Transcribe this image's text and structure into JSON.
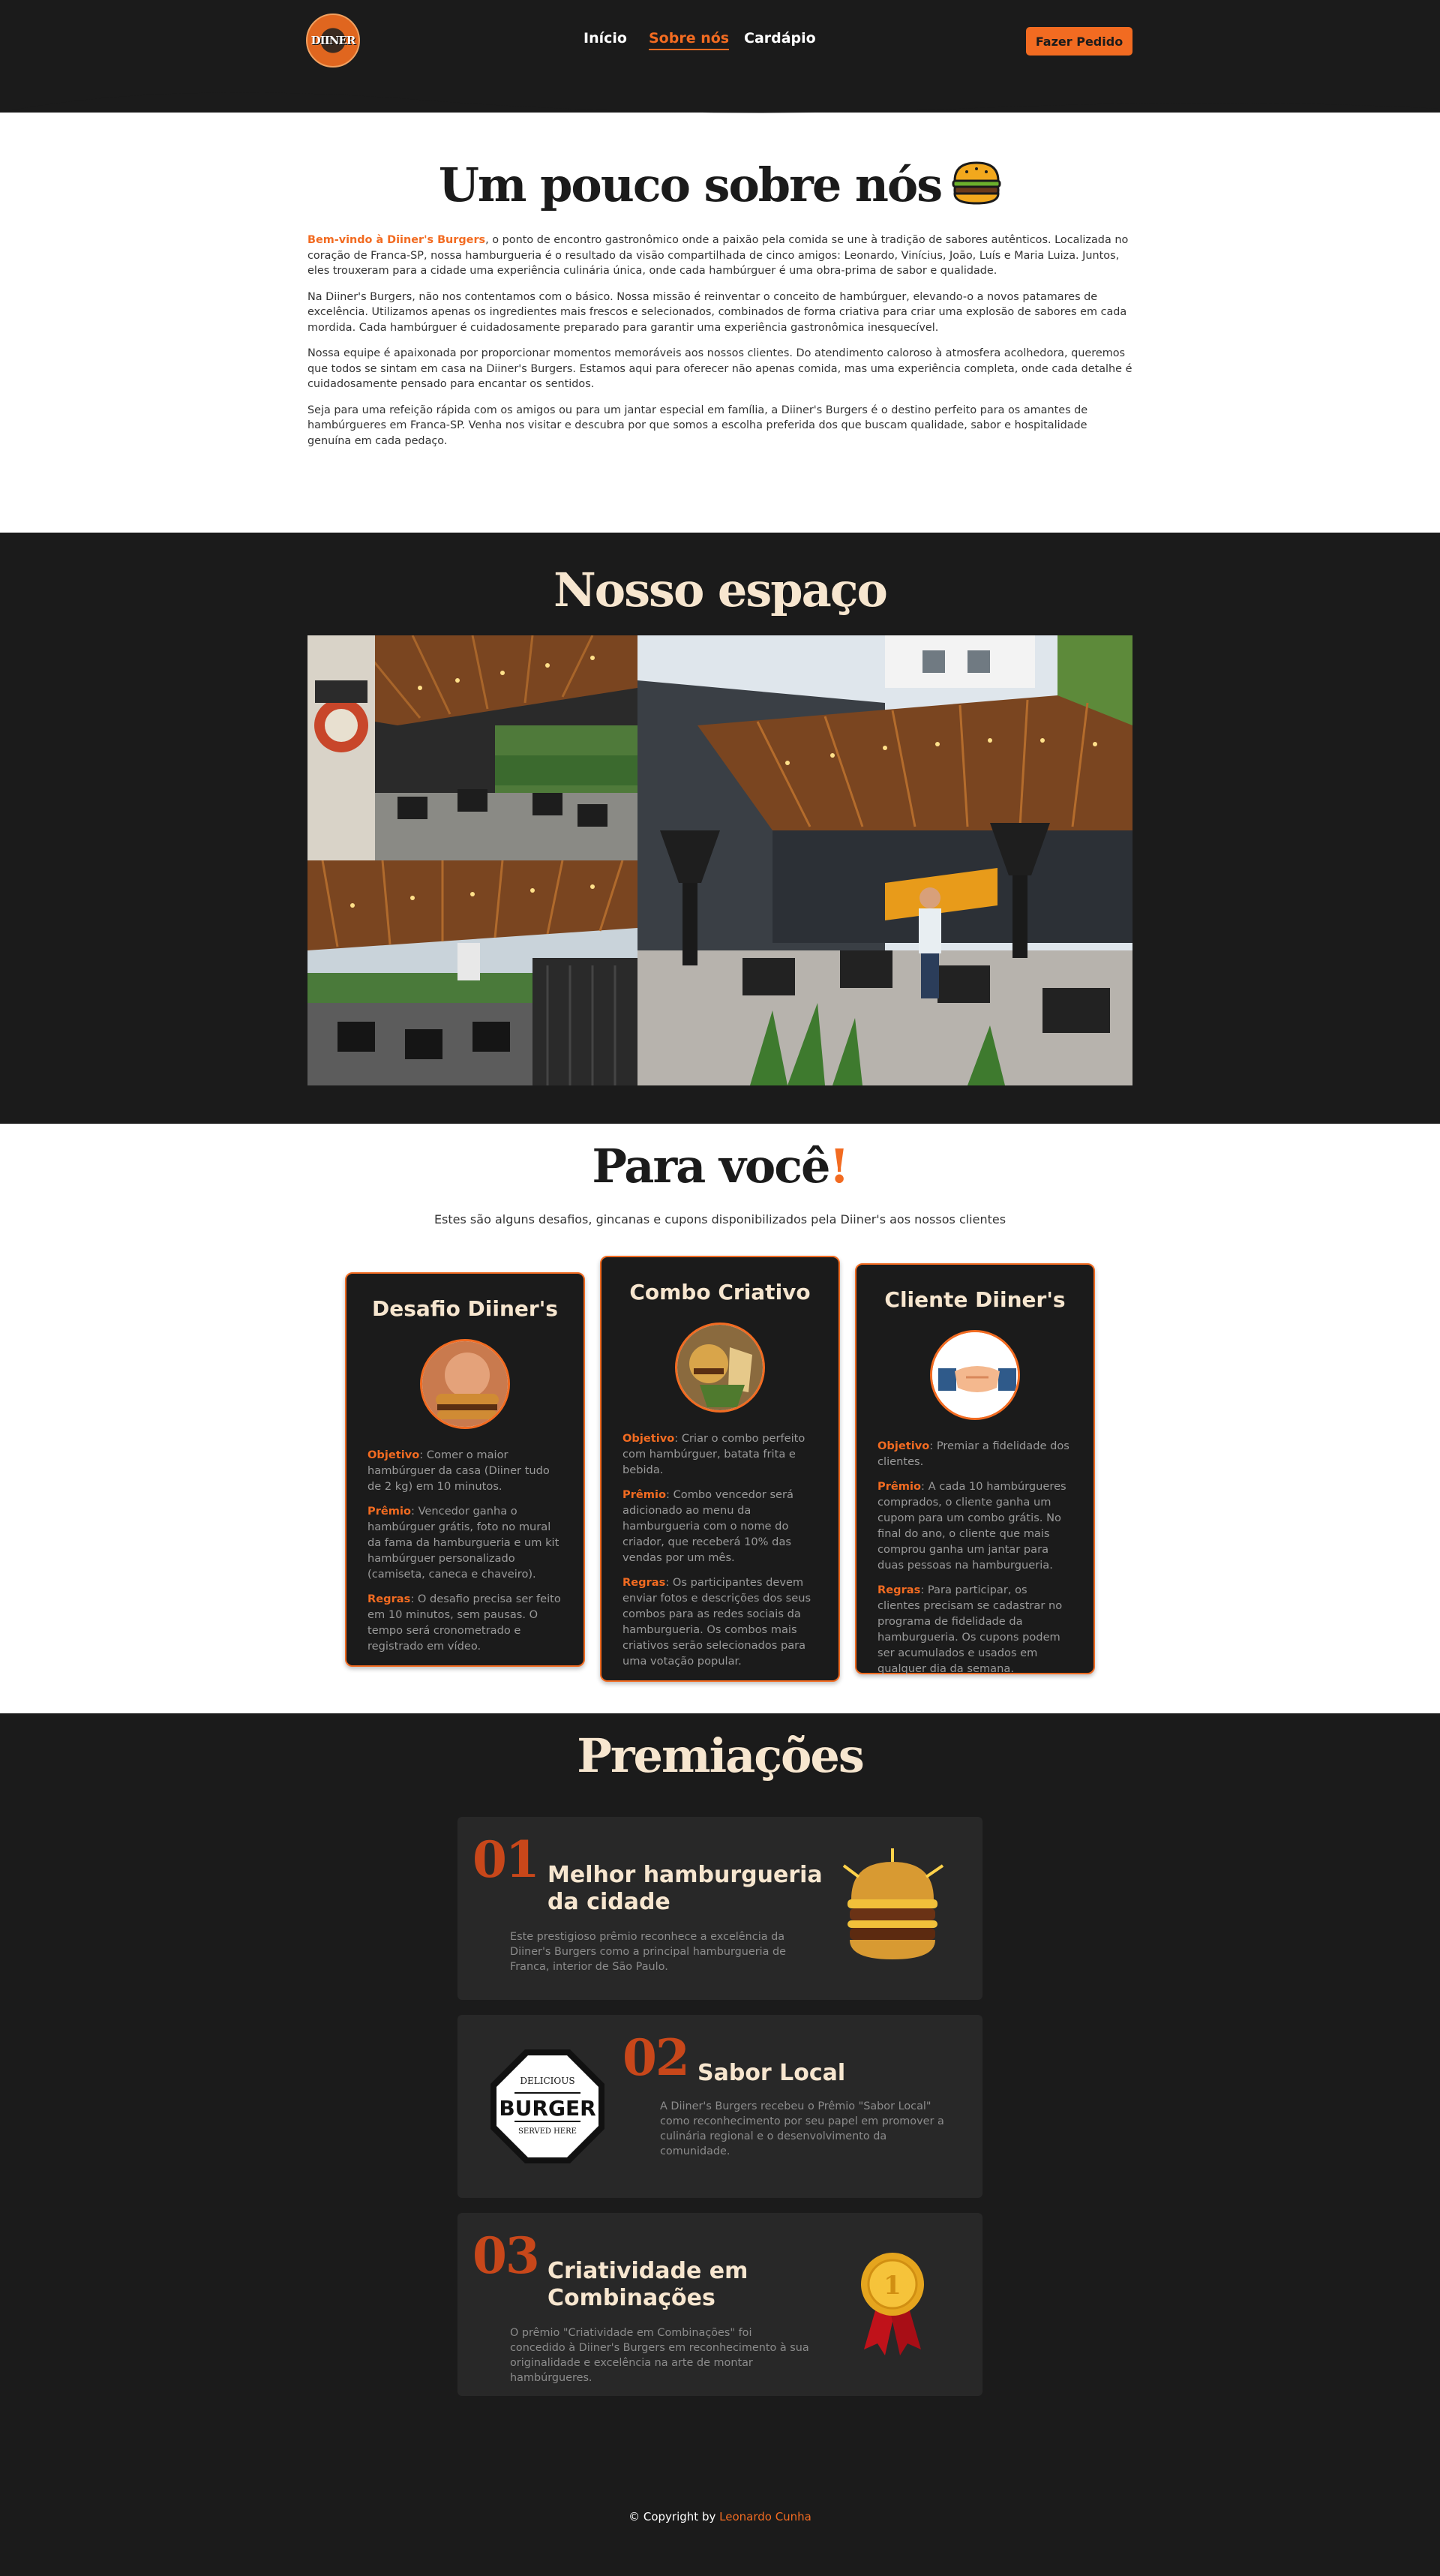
{
  "header": {
    "logo_text": "DIINER",
    "nav": [
      {
        "label": "Início",
        "active": false
      },
      {
        "label": "Sobre nós",
        "active": true
      },
      {
        "label": "Cardápio",
        "active": false
      }
    ],
    "order_button": "Fazer Pedido",
    "accent_color": "#f26b21"
  },
  "about": {
    "title": "Um pouco sobre nós",
    "title_icon": "burger-icon",
    "highlight": "Bem-vindo à Diiner's Burgers",
    "p1_rest": ", o ponto de encontro gastronômico onde a paixão pela comida se une à tradição de sabores autênticos. Localizada no coração de Franca-SP, nossa hamburgueria é o resultado da visão compartilhada de cinco amigos: Leonardo, Vinícius, João, Luís e Maria Luiza. Juntos, eles trouxeram para a cidade uma experiência culinária única, onde cada hambúrguer é uma obra-prima de sabor e qualidade.",
    "p2": "Na Diiner's Burgers, não nos contentamos com o básico. Nossa missão é reinventar o conceito de hambúrguer, elevando-o a novos patamares de excelência. Utilizamos apenas os ingredientes mais frescos e selecionados, combinados de forma criativa para criar uma explosão de sabores em cada mordida. Cada hambúrguer é cuidadosamente preparado para garantir uma experiência gastronômica inesquecível.",
    "p3": "Nossa equipe é apaixonada por proporcionar momentos memoráveis aos nossos clientes. Do atendimento caloroso à atmosfera acolhedora, queremos que todos se sintam em casa na Diiner's Burgers. Estamos aqui para oferecer não apenas comida, mas uma experiência completa, onde cada detalhe é cuidadosamente pensado para encantar os sentidos.",
    "p4": "Seja para uma refeição rápida com os amigos ou para um jantar especial em família, a Diiner's Burgers é o destino perfeito para os amantes de hambúrgueres em Franca-SP. Venha nos visitar e descubra por que somos a escolha preferida dos que buscam qualidade, sabor e hospitalidade genuína em cada pedaço."
  },
  "space": {
    "title": "Nosso espaço"
  },
  "for_you": {
    "title": "Para você",
    "title_mark": "!",
    "subtitle": "Estes são alguns desafios, gincanas e cupons disponibilizados pela Diiner's aos nossos clientes",
    "objective_label": "Objetivo",
    "prize_label": "Prêmio",
    "rules_label": "Regras",
    "cards": [
      {
        "title": "Desafio Diiner's",
        "objective": ": Comer o maior hambúrguer da casa (Diiner tudo de 2 kg) em 10 minutos.",
        "prize": ": Vencedor ganha o hambúrguer grátis, foto no mural da fama da hamburgueria e um kit hambúrguer personalizado (camiseta, caneca e chaveiro).",
        "rules": ": O desafio precisa ser feito em 10 minutos, sem pausas. O tempo será cronometrado e registrado em vídeo."
      },
      {
        "title": "Combo Criativo",
        "objective": ": Criar o combo perfeito com hambúrguer, batata frita e bebida.",
        "prize": ": Combo vencedor será adicionado ao menu da hamburgueria com o nome do criador, que receberá 10% das vendas por um mês.",
        "rules": ": Os participantes devem enviar fotos e descrições dos seus combos para as redes sociais da hamburgueria. Os combos mais criativos serão selecionados para uma votação popular."
      },
      {
        "title": "Cliente Diiner's",
        "objective": ": Premiar a fidelidade dos clientes.",
        "prize": ": A cada 10 hambúrgueres comprados, o cliente ganha um cupom para um combo grátis. No final do ano, o cliente que mais comprou ganha um jantar para duas pessoas na hamburgueria.",
        "rules": ": Para participar, os clientes precisam se cadastrar no programa de fidelidade da hamburgueria. Os cupons podem ser acumulados e usados em qualquer dia da semana."
      }
    ]
  },
  "awards": {
    "title": "Premiações",
    "items": [
      {
        "number": "01",
        "title": "Melhor hamburgueria da cidade",
        "desc": "Este prestigioso prêmio reconhece a excelência da Diiner's Burgers como a principal hamburgueria de Franca, interior de São Paulo.",
        "icon": "burger-photo"
      },
      {
        "number": "02",
        "title": "Sabor Local",
        "desc": "A Diiner's Burgers recebeu o Prêmio \"Sabor Local\" como reconhecimento por seu papel em promover a culinária regional e o desenvolvimento da comunidade.",
        "icon": "burger-badge-icon",
        "badge_top": "DELICIOUS",
        "badge_main": "BURGER",
        "badge_bottom": "SERVED HERE"
      },
      {
        "number": "03",
        "title": "Criatividade em Combinações",
        "desc": "O prêmio \"Criatividade em Combinações\" foi concedido à Diiner's Burgers em reconhecimento à sua originalidade e excelência na arte de montar hambúrgueres.",
        "icon": "gold-medal-icon",
        "medal_text": "1"
      }
    ]
  },
  "footer": {
    "prefix": "© Copyright by",
    "author": "Leonardo Cunha"
  }
}
